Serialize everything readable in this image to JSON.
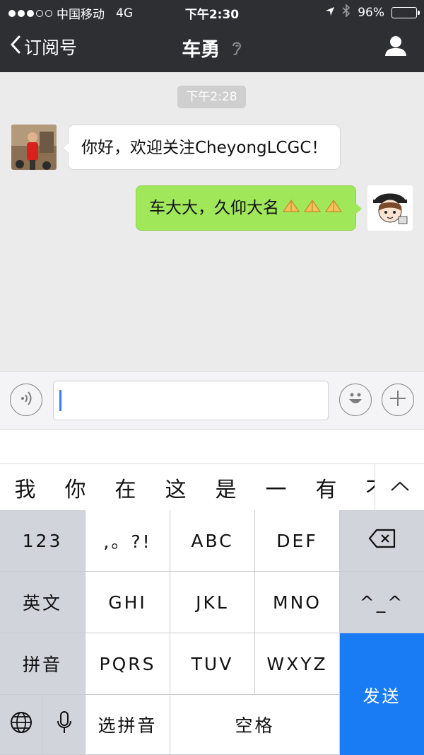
{
  "status_bar": {
    "carrier": "中国移动",
    "network": "4G",
    "time": "下午2:30",
    "battery": "96%",
    "battery_level": 0.96
  },
  "nav": {
    "back_label": "订阅号",
    "title": "车勇"
  },
  "chat": {
    "timestamp": "下午2:28",
    "messages": [
      {
        "from": "other",
        "text": "你好，欢迎关注CheyongLCGC！"
      },
      {
        "from": "me",
        "text": "车大大，久仰大名",
        "emoji": [
          "pray-hands-icon",
          "pray-hands-icon",
          "pray-hands-icon"
        ]
      }
    ]
  },
  "input": {
    "value": ""
  },
  "candidates": [
    "我",
    "你",
    "在",
    "这",
    "是",
    "一",
    "有",
    "不"
  ],
  "keyboard": {
    "k_123": "123",
    "k_punct": ",。?!",
    "k_abc": "ABC",
    "k_def": "DEF",
    "k_english": "英文",
    "k_ghi": "GHI",
    "k_jkl": "JKL",
    "k_mno": "MNO",
    "k_emoticon": "^_^",
    "k_pinyin": "拼音",
    "k_pqrs": "PQRS",
    "k_tuv": "TUV",
    "k_wxyz": "WXYZ",
    "k_send": "发送",
    "k_select_pinyin": "选拼音",
    "k_space": "空格"
  },
  "colors": {
    "nav_bg": "#2e2f33",
    "bubble_out": "#a0e75a",
    "send_key": "#1a7cf5"
  }
}
